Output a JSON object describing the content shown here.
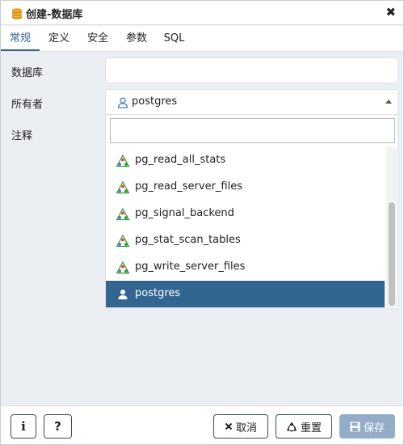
{
  "dialog": {
    "title": "创建-数据库",
    "close_symbol": "✖"
  },
  "tabs": [
    {
      "label": "常规",
      "active": true
    },
    {
      "label": "定义",
      "active": false
    },
    {
      "label": "安全",
      "active": false
    },
    {
      "label": "参数",
      "active": false
    },
    {
      "label": "SQL",
      "active": false
    }
  ],
  "form": {
    "database_label": "数据库",
    "database_value": "",
    "owner_label": "所有者",
    "owner_value": "postgres",
    "comment_label": "注释"
  },
  "dropdown": {
    "search_value": "",
    "items": [
      {
        "label": "pg_read_all_stats",
        "icon": "group-roles-icon",
        "selected": false
      },
      {
        "label": "pg_read_server_files",
        "icon": "group-roles-icon",
        "selected": false
      },
      {
        "label": "pg_signal_backend",
        "icon": "group-roles-icon",
        "selected": false
      },
      {
        "label": "pg_stat_scan_tables",
        "icon": "group-roles-icon",
        "selected": false
      },
      {
        "label": "pg_write_server_files",
        "icon": "group-roles-icon",
        "selected": false
      },
      {
        "label": "postgres",
        "icon": "user-icon",
        "selected": true
      }
    ]
  },
  "footer": {
    "info_symbol": "i",
    "help_symbol": "?",
    "cancel_label": "取消",
    "reset_label": "重置",
    "save_label": "保存"
  },
  "colors": {
    "accent": "#326690",
    "background": "#ebeef3",
    "save_disabled": "#93adc8",
    "group_icon_green": "#3a9b3a",
    "group_icon_red": "#d9534f",
    "group_icon_blue": "#4a7fbf"
  }
}
